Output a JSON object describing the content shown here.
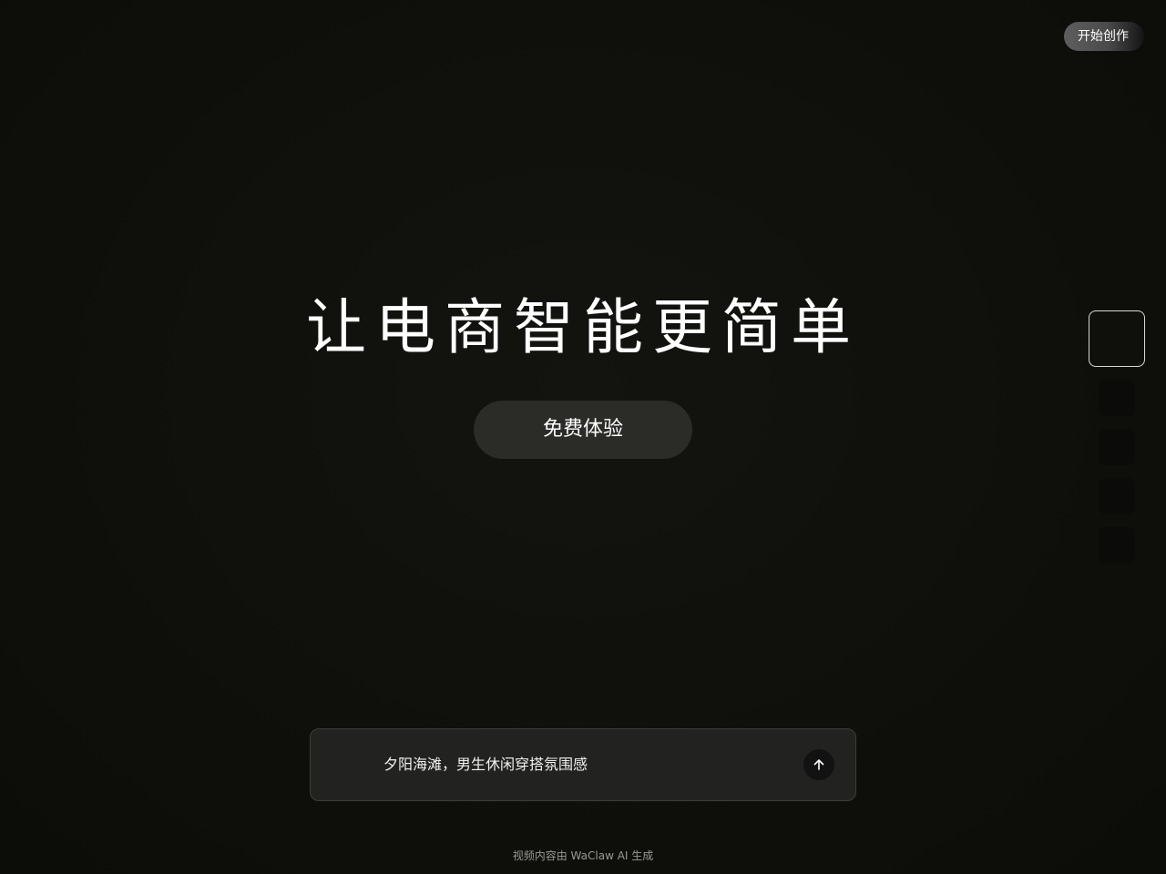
{
  "header": {
    "start_button_label": "开始创作"
  },
  "hero": {
    "title": "让电商智能更简单",
    "cta_label": "免费体验"
  },
  "thumbnails": {
    "count": 5,
    "active_index": 0
  },
  "prompt": {
    "text": "夕阳海滩，男生休闲穿搭氛围感",
    "send_icon": "arrow-up-icon"
  },
  "footer": {
    "note": "视频内容由 WaClaw AI 生成"
  },
  "colors": {
    "background": "#0f0f0b",
    "cta_background": "#2b2b27",
    "prompt_background": "#222220",
    "thumb_border_active": "#d9d9d9"
  }
}
